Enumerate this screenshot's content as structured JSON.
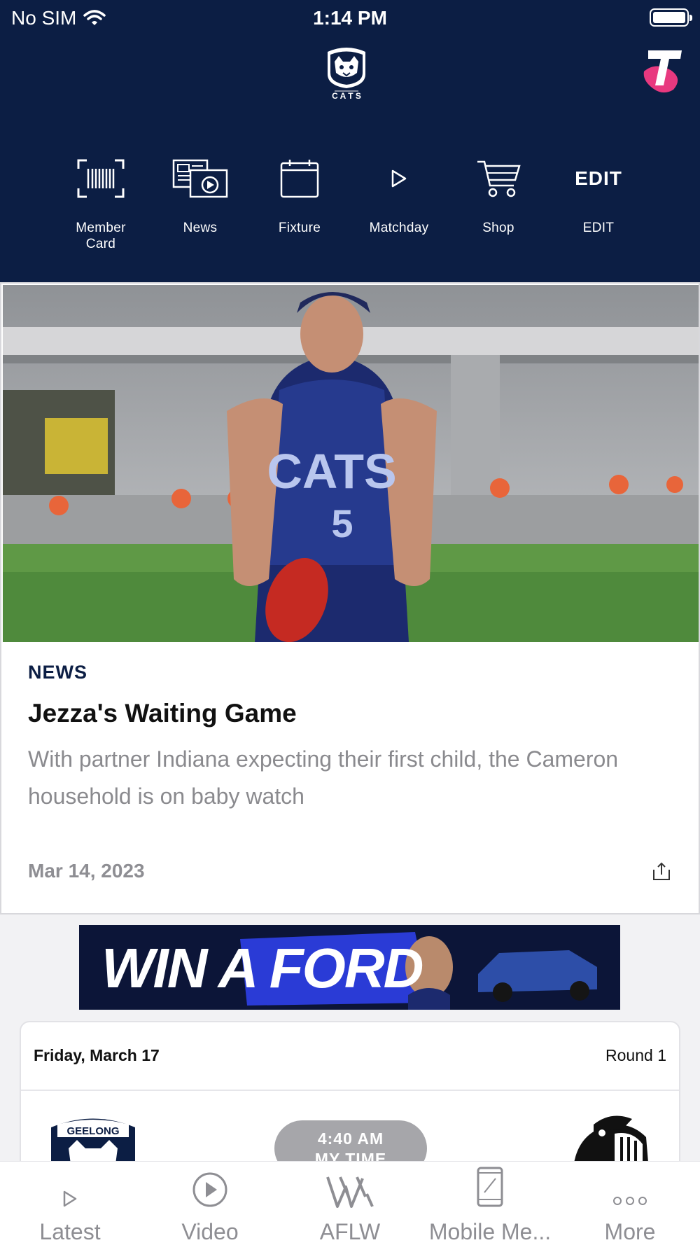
{
  "status_bar": {
    "carrier": "No SIM",
    "time": "1:14 PM"
  },
  "header": {
    "club_logo_icon": "geelong-cats-logo",
    "sponsor_logo_icon": "telstra-logo",
    "quick_nav": [
      {
        "icon": "barcode-icon",
        "label": "Member Card"
      },
      {
        "icon": "news-icon",
        "label": "News"
      },
      {
        "icon": "calendar-icon",
        "label": "Fixture"
      },
      {
        "icon": "play-icon",
        "label": "Matchday"
      },
      {
        "icon": "cart-icon",
        "label": "Shop"
      },
      {
        "icon": "edit-text",
        "glyph": "EDIT",
        "label": "EDIT"
      }
    ]
  },
  "feature": {
    "category": "NEWS",
    "headline": "Jezza's Waiting Game",
    "summary": "With partner Indiana expecting their first child, the Cameron household is on baby watch",
    "date": "Mar 14, 2023",
    "image_icon": "player-photo"
  },
  "banner": {
    "text": "WIN A FORD"
  },
  "fixture": {
    "date": "Friday, March 17",
    "round": "Round 1",
    "time": "4:40 AM",
    "time_suffix": "MY TIME"
  },
  "tabbar": {
    "items": [
      {
        "icon": "play-icon",
        "label": "Latest"
      },
      {
        "icon": "video-icon",
        "label": "Video"
      },
      {
        "icon": "aflw-icon",
        "label": "AFLW"
      },
      {
        "icon": "mobile-icon",
        "label": "Mobile Me..."
      },
      {
        "icon": "more-icon",
        "label": "More"
      }
    ]
  },
  "colors": {
    "navy": "#0c1e44",
    "telstra_pink": "#e8397f",
    "muted": "#8e8e93"
  }
}
